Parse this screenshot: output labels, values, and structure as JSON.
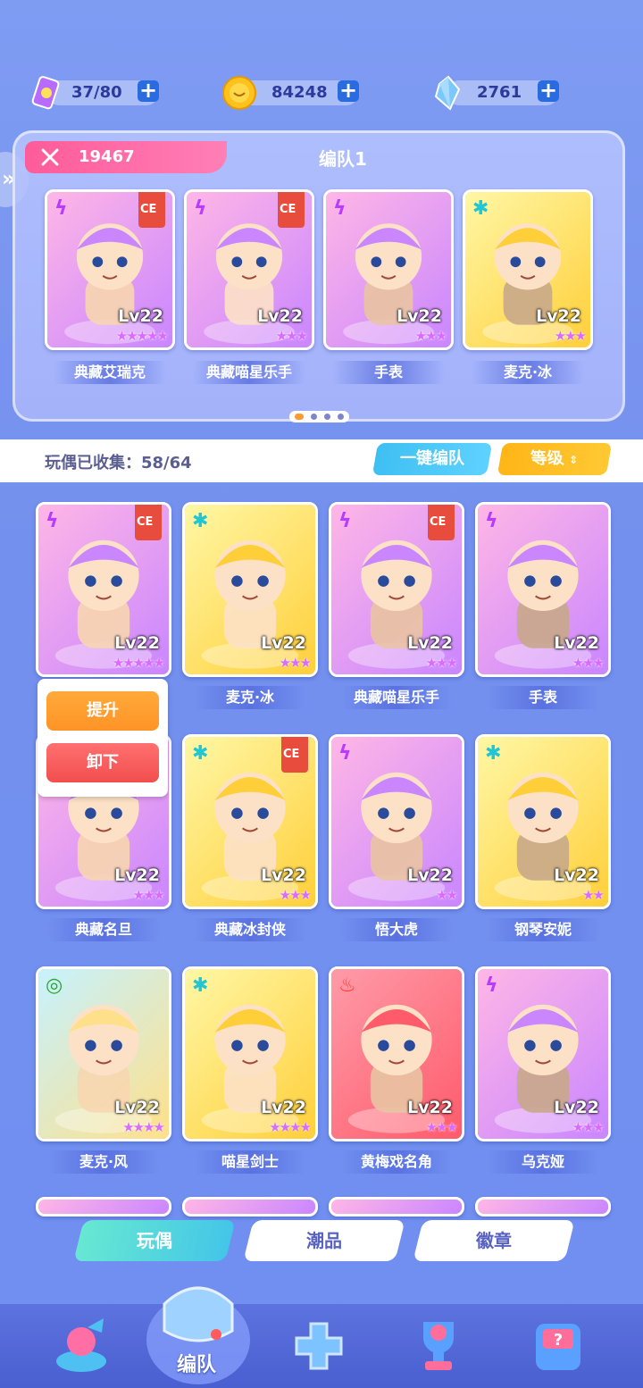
{
  "resources": {
    "stamina": {
      "value": "37/80",
      "icon": "ticket-icon"
    },
    "coins": {
      "value": "84248",
      "icon": "coin-icon"
    },
    "crystals": {
      "value": "2761",
      "icon": "crystal-icon"
    }
  },
  "team": {
    "power": "19467",
    "name": "编队1",
    "members": [
      {
        "name": "典藏艾瑞克",
        "level": "Lv22",
        "stars": "★★★★★",
        "element": "light",
        "ce": true
      },
      {
        "name": "典藏喵星乐手",
        "level": "Lv22",
        "stars": "★★★",
        "element": "light",
        "ce": true
      },
      {
        "name": "手表",
        "level": "Lv22",
        "stars": "★★★",
        "element": "light",
        "ce": false
      },
      {
        "name": "麦克·冰",
        "level": "Lv22",
        "stars": "★★★",
        "element": "ice",
        "ce": false
      }
    ],
    "page_count": 4,
    "current_page": 1
  },
  "collection": {
    "label": "玩偶已收集：58/64",
    "auto_team_button": "一键编队",
    "sort_button": "等级"
  },
  "popup": {
    "upgrade": "提升",
    "unequip": "卸下"
  },
  "dolls": [
    {
      "name": "典藏艾瑞克",
      "level": "Lv22",
      "stars": "★★★★★",
      "element": "light",
      "ce": true
    },
    {
      "name": "麦克·冰",
      "level": "Lv22",
      "stars": "★★★",
      "element": "ice",
      "ce": false
    },
    {
      "name": "典藏喵星乐手",
      "level": "Lv22",
      "stars": "★★★",
      "element": "light",
      "ce": true
    },
    {
      "name": "手表",
      "level": "Lv22",
      "stars": "★★★",
      "element": "light",
      "ce": false
    },
    {
      "name": "典藏名旦",
      "level": "Lv22",
      "stars": "★★★",
      "element": "light",
      "ce": false
    },
    {
      "name": "典藏冰封侠",
      "level": "Lv22",
      "stars": "★★★",
      "element": "ice",
      "ce": true
    },
    {
      "name": "悟大虎",
      "level": "Lv22",
      "stars": "★★",
      "element": "light",
      "ce": false
    },
    {
      "name": "钢琴安妮",
      "level": "Lv22",
      "stars": "★★",
      "element": "ice",
      "ce": false
    },
    {
      "name": "麦克·风",
      "level": "Lv22",
      "stars": "★★★★",
      "element": "wind",
      "ce": false
    },
    {
      "name": "喵星剑士",
      "level": "Lv22",
      "stars": "★★★★",
      "element": "ice",
      "ce": false
    },
    {
      "name": "黄梅戏名角",
      "level": "Lv22",
      "stars": "★★★",
      "element": "fire",
      "ce": false
    },
    {
      "name": "乌克娅",
      "level": "Lv22",
      "stars": "★★★",
      "element": "light",
      "ce": false
    }
  ],
  "tabs": [
    {
      "label": "玩偶",
      "active": true
    },
    {
      "label": "潮品",
      "active": false
    },
    {
      "label": "徽章",
      "active": false
    }
  ],
  "nav": {
    "active_label": "编队",
    "items": [
      "gacha-icon",
      "team-whistle-icon",
      "gamepad-icon",
      "trophy-icon",
      "mystery-box-icon"
    ]
  },
  "colors": {
    "background": "#7490ee",
    "power_badge": "#ff5b9a",
    "auto_team_button": "#3ebff2",
    "sort_button": "#ffb517",
    "upgrade_button": "#ff9a2e",
    "unequip_button": "#f24e4e",
    "star": "#d96bff"
  }
}
